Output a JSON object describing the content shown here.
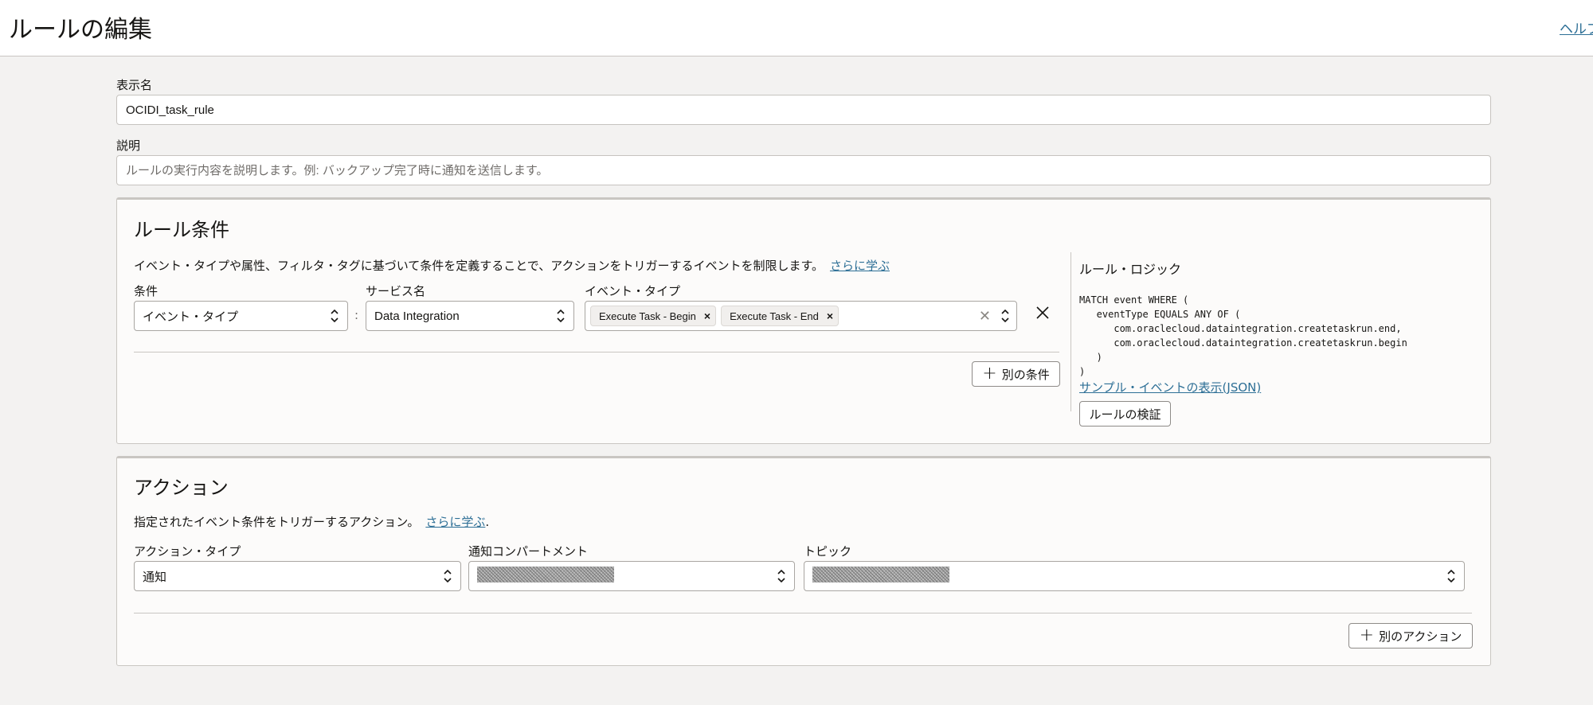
{
  "header": {
    "title": "ルールの編集",
    "help_label": "ヘルプ"
  },
  "form": {
    "display_name_label": "表示名",
    "display_name_value": "OCIDI_task_rule",
    "description_label": "説明",
    "description_placeholder": "ルールの実行内容を説明します。例: バックアップ完了時に通知を送信します。"
  },
  "rule_conditions": {
    "title": "ルール条件",
    "description": "イベント・タイプや属性、フィルタ・タグに基づいて条件を定義することで、アクションをトリガーするイベントを制限します。",
    "learn_more": "さらに学ぶ",
    "condition_label": "条件",
    "condition_value": "イベント・タイプ",
    "service_label": "サービス名",
    "service_value": "Data Integration",
    "event_type_label": "イベント・タイプ",
    "event_types": [
      {
        "label": "Execute Task - Begin"
      },
      {
        "label": "Execute Task - End"
      }
    ],
    "add_condition_label": "別の条件"
  },
  "rule_logic": {
    "title": "ルール・ロジック",
    "code": "MATCH event WHERE (\n   eventType EQUALS ANY OF (\n      com.oraclecloud.dataintegration.createtaskrun.end,\n      com.oraclecloud.dataintegration.createtaskrun.begin\n   )\n)",
    "sample_link": "サンプル・イベントの表示(JSON)",
    "validate_label": "ルールの検証"
  },
  "actions": {
    "title": "アクション",
    "description": "指定されたイベント条件をトリガーするアクション。",
    "learn_more": "さらに学ぶ",
    "learn_more_suffix": ".",
    "action_type_label": "アクション・タイプ",
    "action_type_value": "通知",
    "compartment_label": "通知コンパートメント",
    "topic_label": "トピック",
    "add_action_label": "別のアクション"
  },
  "icons": {
    "updown": "chevron-up-down-icon",
    "remove": "close-icon",
    "chip_remove": "chip-remove-icon",
    "clear": "clear-icon",
    "plus": "plus-icon"
  },
  "colors": {
    "link": "#2d6f96",
    "background": "#f3f2f1",
    "panel": "#fcfbfa"
  }
}
